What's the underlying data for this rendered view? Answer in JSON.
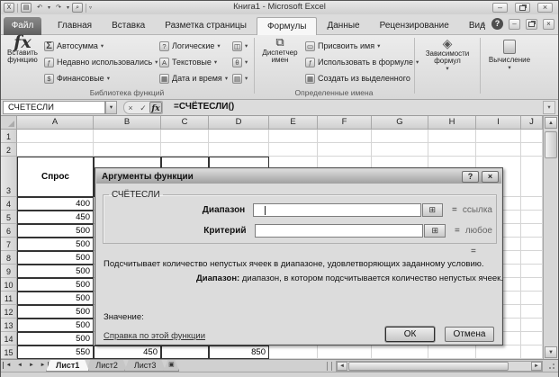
{
  "window": {
    "title": "Книга1  -  Microsoft Excel"
  },
  "icons": {
    "dropdown": "▾",
    "sigma": "Σ",
    "fx": "fx",
    "close": "×",
    "help": "?",
    "minimize": "–",
    "check": "✓",
    "cancel": "×",
    "range_select": "⊞",
    "up": "▲",
    "down": "▼",
    "left": "◄",
    "right": "►",
    "ribbon_collapse": "∧",
    "undo": "↶",
    "redo": "↷"
  },
  "tabs": {
    "file": "Файл",
    "items": [
      "Главная",
      "Вставка",
      "Разметка страницы",
      "Формулы",
      "Данные",
      "Рецензирование",
      "Вид"
    ],
    "active": "Формулы"
  },
  "ribbon": {
    "insert_function": "Вставить функцию",
    "library": {
      "label": "Библиотека функций",
      "autosum": "Автосумма",
      "recent": "Недавно использовались",
      "financial": "Финансовые",
      "logical": "Логические",
      "text": "Текстовые",
      "datetime": "Дата и время"
    },
    "defined_names": {
      "label": "Определенные имена",
      "name_manager": "Диспетчер имен",
      "define_name": "Присвоить имя",
      "use_in_formula": "Использовать в формуле",
      "create_from_selection": "Создать из выделенного"
    },
    "formula_auditing": "Зависимости формул",
    "calculation": "Вычисление"
  },
  "formula_bar": {
    "name_box": "СЧЕТЕСЛИ",
    "formula": "=СЧЁТЕСЛИ()"
  },
  "grid": {
    "columns": [
      "A",
      "B",
      "C",
      "D",
      "E",
      "F",
      "G",
      "H",
      "I",
      "J"
    ],
    "rows": [
      1,
      2,
      3,
      4,
      5,
      6,
      7,
      8,
      9,
      10,
      11,
      12,
      13,
      14,
      15
    ],
    "cells": {
      "A3": "Спрос",
      "A4": "400",
      "A5": "450",
      "A6": "500",
      "A7": "500",
      "A8": "500",
      "A9": "500",
      "A10": "500",
      "A11": "500",
      "A12": "500",
      "A13": "500",
      "A14": "500",
      "A15": "550",
      "B15": "450",
      "D15": "850"
    },
    "bordered_cells": [
      "A3",
      "A4",
      "A5",
      "A6",
      "A7",
      "A8",
      "A9",
      "A10",
      "A11",
      "A12",
      "A13",
      "A14",
      "A15",
      "B3",
      "C3",
      "D3",
      "B15",
      "C15",
      "D15"
    ]
  },
  "dialog": {
    "title": "Аргументы функции",
    "function_name": "СЧЁТЕСЛИ",
    "fields": [
      {
        "label": "Диапазон",
        "value": "",
        "hint": "ссылка"
      },
      {
        "label": "Критерий",
        "value": "",
        "hint": "любое"
      }
    ],
    "equals": "=",
    "description": "Подсчитывает количество непустых ячеек в диапазоне, удовлетворяющих заданному условию.",
    "arg_name": "Диапазон:",
    "arg_help": " диапазон, в котором подсчитывается количество непустых ячеек.",
    "value_label": "Значение:",
    "help_link": "Справка по этой функции",
    "ok": "ОК",
    "cancel": "Отмена"
  },
  "sheet_tabs": {
    "items": [
      "Лист1",
      "Лист2",
      "Лист3"
    ],
    "active": "Лист1"
  }
}
